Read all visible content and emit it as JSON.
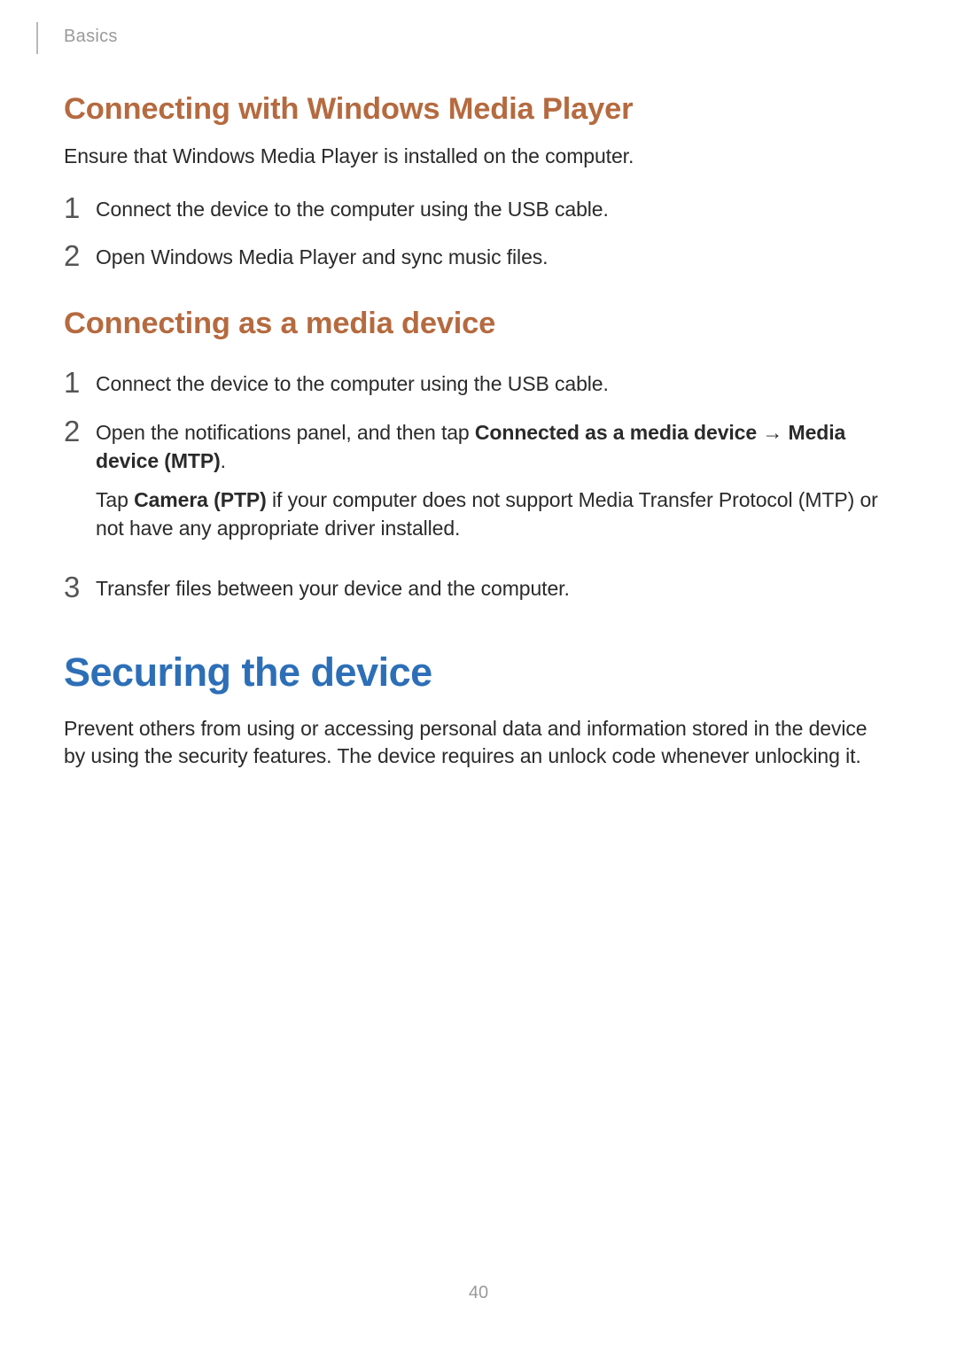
{
  "header": {
    "section": "Basics"
  },
  "section1": {
    "heading": "Connecting with Windows Media Player",
    "intro": "Ensure that Windows Media Player is installed on the computer.",
    "steps": {
      "n1": "1",
      "s1": "Connect the device to the computer using the USB cable.",
      "n2": "2",
      "s2": "Open Windows Media Player and sync music files."
    }
  },
  "section2": {
    "heading": "Connecting as a media device",
    "steps": {
      "n1": "1",
      "s1": "Connect the device to the computer using the USB cable.",
      "n2": "2",
      "s2_pre": "Open the notifications panel, and then tap ",
      "s2_bold1": "Connected as a media device",
      "s2_arrow": " → ",
      "s2_bold2": "Media device (MTP)",
      "s2_post": ".",
      "s2_follow_pre": "Tap ",
      "s2_follow_bold": "Camera (PTP)",
      "s2_follow_post": " if your computer does not support Media Transfer Protocol (MTP) or not have any appropriate driver installed.",
      "n3": "3",
      "s3": "Transfer files between your device and the computer."
    }
  },
  "section3": {
    "heading": "Securing the device",
    "body": "Prevent others from using or accessing personal data and information stored in the device by using the security features. The device requires an unlock code whenever unlocking it."
  },
  "page_number": "40"
}
